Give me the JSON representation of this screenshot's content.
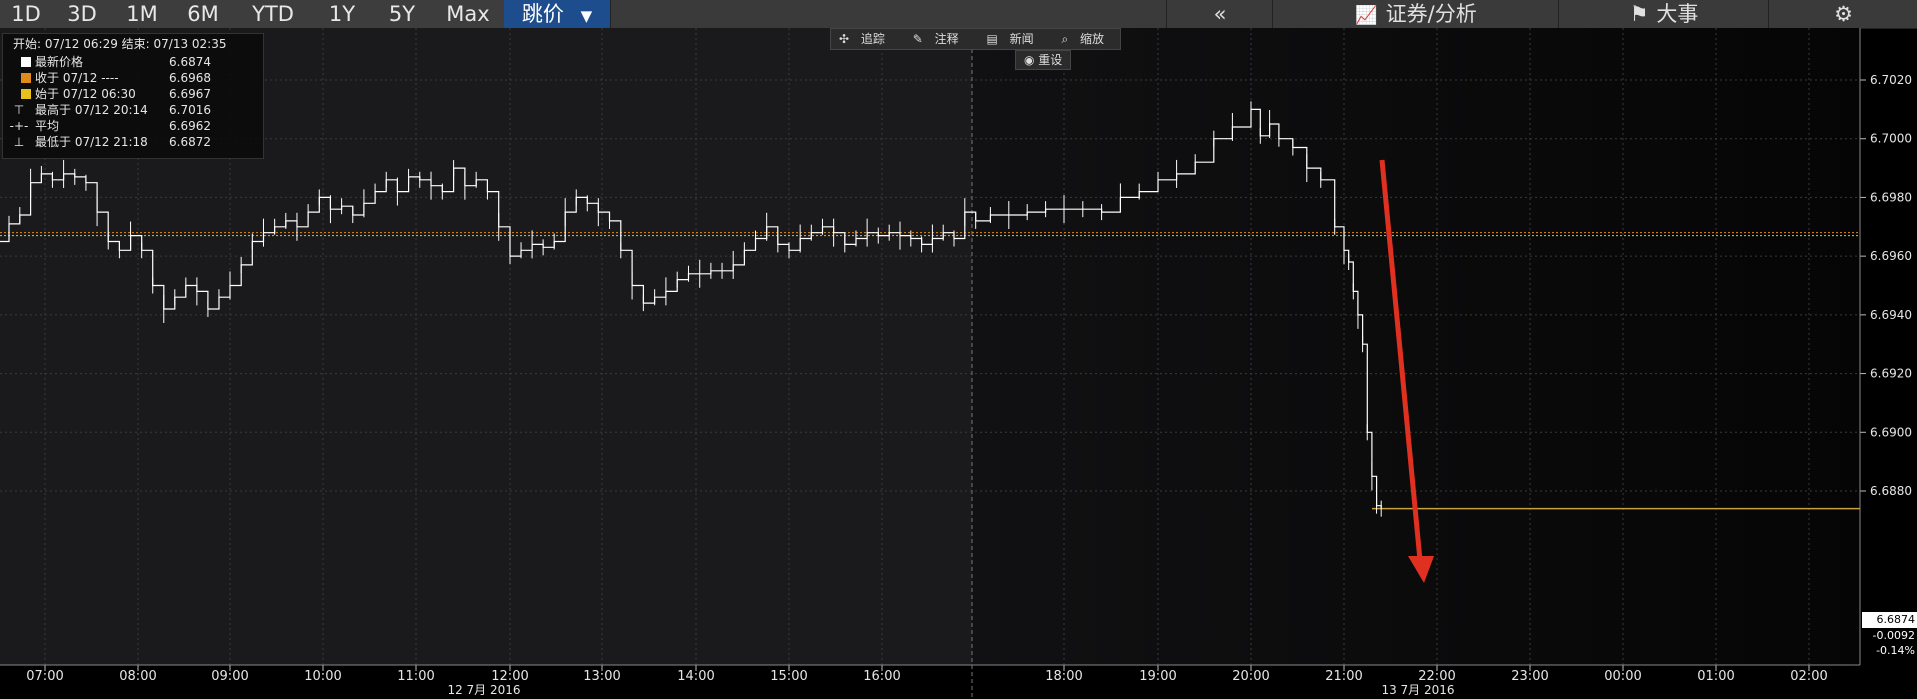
{
  "tabs": [
    {
      "label": "1D"
    },
    {
      "label": "3D"
    },
    {
      "label": "1M"
    },
    {
      "label": "6M"
    },
    {
      "label": "YTD"
    },
    {
      "label": "1Y"
    },
    {
      "label": "5Y"
    },
    {
      "label": "Max"
    },
    {
      "label": "跳价",
      "selected": true
    }
  ],
  "toolbar_right": {
    "back_label": "«",
    "securities_label": "证券/分析",
    "events_label": "大事",
    "settings_icon": "gear-icon"
  },
  "tools": {
    "track": "追踪",
    "annotate": "注释",
    "news": "新闻",
    "zoom": "缩放",
    "reset": "重设"
  },
  "legend": {
    "header": "开始: 07/12 06:29 结束: 07/13 02:35",
    "rows": [
      {
        "label": "最新价格",
        "value": "6.6874",
        "color": "#ffffff"
      },
      {
        "label": "收于 07/12 ----",
        "value": "6.6968",
        "color": "#e08a1a"
      },
      {
        "label": "始于 07/12 06:30",
        "value": "6.6967",
        "color": "#e6c21a"
      },
      {
        "label": "最高于 07/12 20:14",
        "value": "6.7016",
        "color": ""
      },
      {
        "label": "平均",
        "value": "6.6962",
        "color": ""
      },
      {
        "label": "最低于 07/12 21:18",
        "value": "6.6872",
        "color": ""
      }
    ]
  },
  "last_price": {
    "value": "6.6874",
    "change": "-0.0092",
    "pct": "-0.14%"
  },
  "colors": {
    "price_line": "#ffffff",
    "close_line": "#e08a1a",
    "open_line": "#e6c21a",
    "last_line": "#c8a040",
    "arrow": "#e03020",
    "grid": "#3a3a3a"
  },
  "chart_data": {
    "type": "line",
    "y_ticks": [
      "6.7020",
      "6.7000",
      "6.6980",
      "6.6960",
      "6.6940",
      "6.6920",
      "6.6900",
      "6.6880"
    ],
    "x_ticks": [
      "07:00",
      "08:00",
      "09:00",
      "10:00",
      "11:00",
      "12:00",
      "13:00",
      "14:00",
      "15:00",
      "16:00",
      "18:00",
      "19:00",
      "20:00",
      "21:00",
      "22:00",
      "23:00",
      "00:00",
      "01:00",
      "02:00"
    ],
    "date_labels": [
      "12 7月 2016",
      "13 7月 2016"
    ],
    "ylim": [
      6.6862,
      6.7038
    ],
    "grid": true,
    "reference_lines": {
      "close": 6.6968,
      "open": 6.6967,
      "last": 6.6874
    },
    "series": [
      {
        "x": [
          6.48,
          6.6,
          6.72,
          6.84,
          6.96,
          7.08,
          7.2,
          7.32,
          7.44,
          7.56,
          7.68,
          7.8,
          7.92,
          8.04,
          8.16,
          8.28,
          8.4,
          8.52,
          8.64,
          8.76,
          8.88,
          9.0,
          9.12,
          9.24,
          9.36,
          9.48,
          9.6,
          9.72,
          9.84,
          9.96,
          10.08,
          10.2,
          10.32,
          10.44,
          10.56,
          10.68,
          10.8,
          10.92,
          11.04,
          11.16,
          11.28,
          11.4,
          11.52,
          11.64,
          11.76,
          11.88,
          12.0,
          12.12,
          12.24,
          12.36,
          12.48,
          12.6,
          12.72,
          12.84,
          12.96,
          13.08,
          13.2,
          13.32,
          13.44,
          13.56,
          13.68,
          13.8,
          13.92,
          14.04,
          14.16,
          14.28,
          14.4,
          14.52,
          14.64,
          14.76,
          14.88,
          15.0,
          15.12,
          15.24,
          15.36,
          15.48,
          15.6,
          15.72,
          15.84,
          15.96,
          16.08,
          16.2,
          16.32,
          16.44,
          16.56,
          16.68,
          16.8,
          16.92,
          17.04,
          17.2,
          17.4,
          17.6,
          17.8,
          18.0,
          18.2,
          18.4,
          18.6,
          18.8,
          19.0,
          19.2,
          19.4,
          19.6,
          19.8,
          20.0,
          20.1,
          20.2,
          20.3,
          20.45,
          20.6,
          20.75,
          20.9,
          21.0,
          21.05,
          21.1,
          21.15,
          21.2,
          21.25,
          21.3,
          21.35,
          21.4
        ],
        "y": [
          6.6965,
          6.6971,
          6.6974,
          6.6985,
          6.6988,
          6.6986,
          6.6988,
          6.6987,
          6.6985,
          6.6975,
          6.6965,
          6.6962,
          6.6967,
          6.6962,
          6.695,
          6.6942,
          6.6946,
          6.695,
          6.6948,
          6.6942,
          6.6946,
          6.695,
          6.6957,
          6.6965,
          6.6968,
          6.697,
          6.6972,
          6.697,
          6.6975,
          6.698,
          6.6976,
          6.6977,
          6.6974,
          6.6978,
          6.6982,
          6.6986,
          6.6982,
          6.6987,
          6.6986,
          6.6984,
          6.6982,
          6.699,
          6.6984,
          6.6986,
          6.6982,
          6.697,
          6.696,
          6.6962,
          6.6964,
          6.6963,
          6.6965,
          6.6975,
          6.698,
          6.6978,
          6.6975,
          6.6972,
          6.6962,
          6.695,
          6.6944,
          6.6946,
          6.6948,
          6.6952,
          6.6954,
          6.6954,
          6.6955,
          6.6955,
          6.6957,
          6.6962,
          6.6966,
          6.697,
          6.6964,
          6.6962,
          6.6966,
          6.6968,
          6.697,
          6.6968,
          6.6964,
          6.6966,
          6.6968,
          6.6967,
          6.6968,
          6.6967,
          6.6966,
          6.6964,
          6.6966,
          6.6968,
          6.6966,
          6.6975,
          6.6972,
          6.6974,
          6.6974,
          6.6975,
          6.6976,
          6.6976,
          6.6976,
          6.6975,
          6.698,
          6.6982,
          6.6986,
          6.6988,
          6.6992,
          6.7,
          6.7004,
          6.701,
          6.7001,
          6.7005,
          6.7,
          6.6997,
          6.699,
          6.6986,
          6.697,
          6.6962,
          6.6958,
          6.6948,
          6.694,
          6.693,
          6.69,
          6.6885,
          6.6875,
          6.6874
        ]
      }
    ]
  }
}
